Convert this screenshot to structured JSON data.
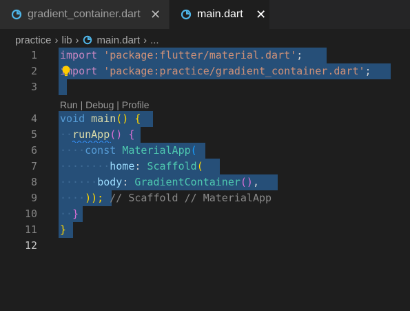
{
  "tabs": [
    {
      "label": "gradient_container.dart",
      "close": "✕"
    },
    {
      "label": "main.dart",
      "close": "✕"
    }
  ],
  "breadcrumb": {
    "items": [
      "practice",
      "lib",
      "main.dart",
      "..."
    ],
    "separator": "›"
  },
  "codelens": {
    "run": "Run",
    "sep": " | ",
    "debug": "Debug",
    "profile": "Profile"
  },
  "editor": {
    "line_numbers": [
      "1",
      "2",
      "3",
      "4",
      "5",
      "6",
      "7",
      "8",
      "9",
      "10",
      "11",
      "12"
    ],
    "current_line": "12",
    "lines": {
      "l1": {
        "kw": "import",
        "str": "'package:flutter/material.dart'",
        "end": ";"
      },
      "l2": {
        "kw": "import",
        "str": "'package:practice/gradient_container.dart'",
        "end": ";"
      },
      "l4": {
        "kw": "void",
        "fn": "main",
        "p": "()",
        "brace": "{"
      },
      "l5": {
        "fn": "runApp",
        "p": "()",
        "brace": "{"
      },
      "l6": {
        "kw": "const",
        "type": "MaterialApp",
        "p": "("
      },
      "l7": {
        "param": "home",
        "colon": ":",
        "type": "Scaffold",
        "p": "("
      },
      "l8": {
        "param": "body",
        "colon": ":",
        "type": "GradientContainer",
        "p": "()",
        "comma": ","
      },
      "l9": {
        "close": "));",
        "comment": "// Scaffold // MaterialApp"
      },
      "l10": {
        "brace": "}"
      },
      "l11": {
        "brace": "}"
      }
    }
  },
  "colors": {
    "background": "#1e1e1e",
    "selection": "#264f78",
    "keyword": "#569cd6",
    "control_keyword": "#c586c0",
    "string": "#ce9178",
    "function": "#dcdcaa",
    "type": "#4ec9b0",
    "parameter": "#9cdcfe",
    "dart_icon": "#4fb6e9"
  },
  "icons": {
    "tab_file": "dart-file-icon",
    "lightbulb": "lightbulb-icon"
  }
}
